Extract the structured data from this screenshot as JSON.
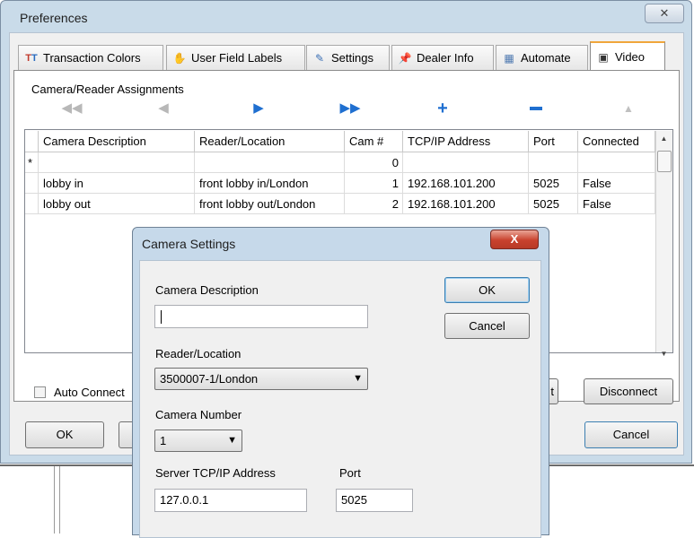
{
  "preferences": {
    "title": "Preferences",
    "close_label": "✕",
    "tabs": [
      {
        "label": "Transaction Colors",
        "icon": "tt-colors-icon"
      },
      {
        "label": "User Field Labels",
        "icon": "user-labels-icon"
      },
      {
        "label": "Settings",
        "icon": "settings-icon"
      },
      {
        "label": "Dealer Info",
        "icon": "pushpin-icon"
      },
      {
        "label": "Automate",
        "icon": "automate-icon"
      },
      {
        "label": "Video",
        "icon": "video-camera-icon",
        "active": true
      }
    ],
    "section_label": "Camera/Reader Assignments",
    "toolbar_icons": [
      "first-icon",
      "prev-icon",
      "next-icon",
      "last-icon",
      "add-icon",
      "remove-icon",
      "save-icon"
    ],
    "grid": {
      "columns": [
        "Camera Description",
        "Reader/Location",
        "Cam #",
        "TCP/IP Address",
        "Port",
        "Connected"
      ],
      "new_row_marker": "*",
      "new_row_cam": "0",
      "rows": [
        {
          "desc": "lobby in",
          "reader": "front lobby in/London",
          "cam": "1",
          "ip": "192.168.101.200",
          "port": "5025",
          "connected": "False"
        },
        {
          "desc": "lobby out",
          "reader": "front lobby out/London",
          "cam": "2",
          "ip": "192.168.101.200",
          "port": "5025",
          "connected": "False"
        }
      ]
    },
    "auto_connect_label": "Auto Connect",
    "test_label": "t",
    "disconnect_label": "Disconnect",
    "ok_label": "OK",
    "cancel_label": "Cancel"
  },
  "camera_settings": {
    "title": "Camera Settings",
    "close_label": "X",
    "description_label": "Camera Description",
    "description_value": "",
    "reader_label": "Reader/Location",
    "reader_value": "3500007-1/London",
    "number_label": "Camera Number",
    "number_value": "1",
    "server_label": "Server TCP/IP Address",
    "server_value": "127.0.0.1",
    "port_label": "Port",
    "port_value": "5025",
    "ok_label": "OK",
    "cancel_label": "Cancel"
  }
}
